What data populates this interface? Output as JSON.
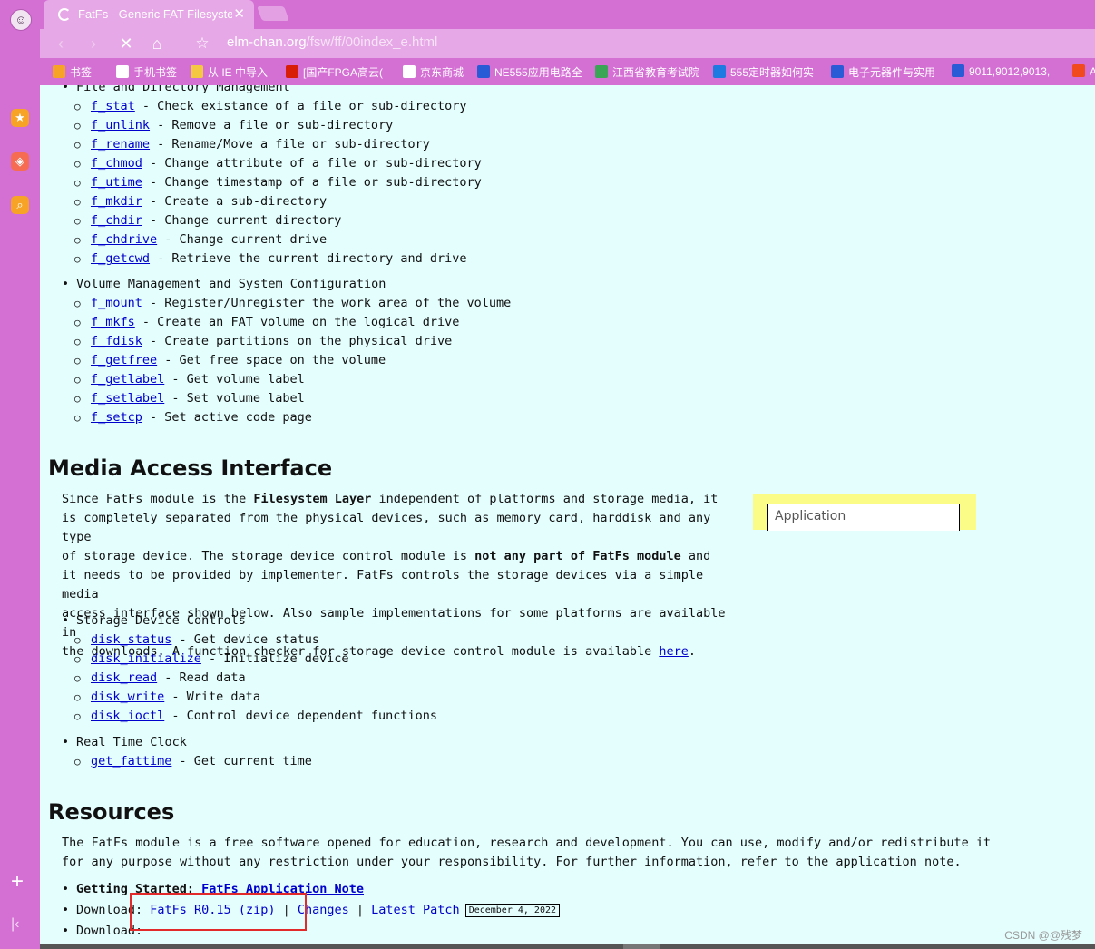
{
  "browser": {
    "tab_title": "FatFs - Generic FAT Filesyste",
    "url_host": "elm-chan.org",
    "url_path": "/fsw/ff/00index_e.html",
    "icons": {
      "back": "‹",
      "forward": "›",
      "stop": "✕",
      "home": "⌂",
      "star": "☆",
      "close": "✕",
      "plus": "+",
      "collapse": "|‹",
      "favorites": "★",
      "apps": "◈",
      "search": "⌕",
      "avatar": "☺"
    }
  },
  "bookmarks": [
    {
      "label": "书签",
      "icon_color": "#f7a325"
    },
    {
      "label": "手机书签",
      "icon_color": "#ffffff"
    },
    {
      "label": "从 IE 中导入",
      "icon_color": "#f5c842"
    },
    {
      "label": "[国产FPGA高云(",
      "icon_color": "#d81e06"
    },
    {
      "label": "京东商城",
      "icon_color": "#ffffff"
    },
    {
      "label": "NE555应用电路全",
      "icon_color": "#2a5bd7"
    },
    {
      "label": "江西省教育考试院",
      "icon_color": "#3aa655"
    },
    {
      "label": "555定时器如何实",
      "icon_color": "#1e7ae0"
    },
    {
      "label": "电子元器件与实用",
      "icon_color": "#2a5bd7"
    },
    {
      "label": "9011,9012,9013,",
      "icon_color": "#2a5bd7"
    },
    {
      "label": "A",
      "icon_color": "#f04a1e"
    }
  ],
  "file_mgmt": {
    "heading": "File and Directory Management",
    "items": [
      {
        "fn": "f_stat",
        "desc": " - Check existance of a file or sub-directory"
      },
      {
        "fn": "f_unlink",
        "desc": " - Remove a file or sub-directory"
      },
      {
        "fn": "f_rename",
        "desc": " - Rename/Move a file or sub-directory"
      },
      {
        "fn": "f_chmod",
        "desc": " - Change attribute of a file or sub-directory"
      },
      {
        "fn": "f_utime",
        "desc": " - Change timestamp of a file or sub-directory"
      },
      {
        "fn": "f_mkdir",
        "desc": " - Create a sub-directory"
      },
      {
        "fn": "f_chdir",
        "desc": " - Change current directory"
      },
      {
        "fn": "f_chdrive",
        "desc": " - Change current drive"
      },
      {
        "fn": "f_getcwd",
        "desc": " - Retrieve the current directory and drive"
      }
    ]
  },
  "volume_mgmt": {
    "heading": "Volume Management and System Configuration",
    "items": [
      {
        "fn": "f_mount",
        "desc": " - Register/Unregister the work area of the volume"
      },
      {
        "fn": "f_mkfs",
        "desc": " - Create an FAT volume on the logical drive"
      },
      {
        "fn": "f_fdisk",
        "desc": " - Create partitions on the physical drive"
      },
      {
        "fn": "f_getfree",
        "desc": " - Get free space on the volume"
      },
      {
        "fn": "f_getlabel",
        "desc": " - Get volume label"
      },
      {
        "fn": "f_setlabel",
        "desc": " - Set volume label"
      },
      {
        "fn": "f_setcp",
        "desc": " - Set active code page"
      }
    ]
  },
  "media": {
    "title": "Media Access Interface",
    "p1": "Since FatFs module is the ",
    "b1": "Filesystem Layer",
    "p2": " independent of platforms and storage media, it",
    "p3": "is completely separated from the physical devices, such as memory card, harddisk and any type",
    "p4": "of storage device. The storage device control module is ",
    "b2": "not any part of FatFs module",
    "p5": " and",
    "p6": "it needs to be provided by implementer. FatFs controls the storage devices via a simple media",
    "p7": "access interface shown below. Also sample implementations for some platforms are available in",
    "p8": "the downloads. A function checker for storage device control module is available ",
    "link": "here",
    "p9": ".",
    "diagram_label": "Application",
    "storage_heading": "Storage Device Controls",
    "storage_items": [
      {
        "fn": "disk_status",
        "desc": " - Get device status"
      },
      {
        "fn": "disk_initialize",
        "desc": " - Initialize device"
      },
      {
        "fn": "disk_read",
        "desc": " - Read data"
      },
      {
        "fn": "disk_write",
        "desc": " - Write data"
      },
      {
        "fn": "disk_ioctl",
        "desc": " - Control device dependent functions"
      }
    ],
    "rtc_heading": "Real Time Clock",
    "rtc_items": [
      {
        "fn": "get_fattime",
        "desc": " - Get current time"
      }
    ]
  },
  "resources": {
    "title": "Resources",
    "line1": "The FatFs module is a free software opened for education, research and development. You can use, modify and/or redistribute it",
    "line2": "for any purpose without any restriction under your responsibility. For further information, refer to the application note.",
    "gs_label": "Getting Started: ",
    "gs_link": "FatFs Application Note",
    "dl_label": "Download: ",
    "dl_link": "FatFs R0.15 (zip)",
    "sep": " | ",
    "changes": "Changes",
    "patch": "Latest Patch",
    "date": "December 4, 2022",
    "dl2_label": "Download: "
  },
  "watermark": "CSDN @@残梦"
}
